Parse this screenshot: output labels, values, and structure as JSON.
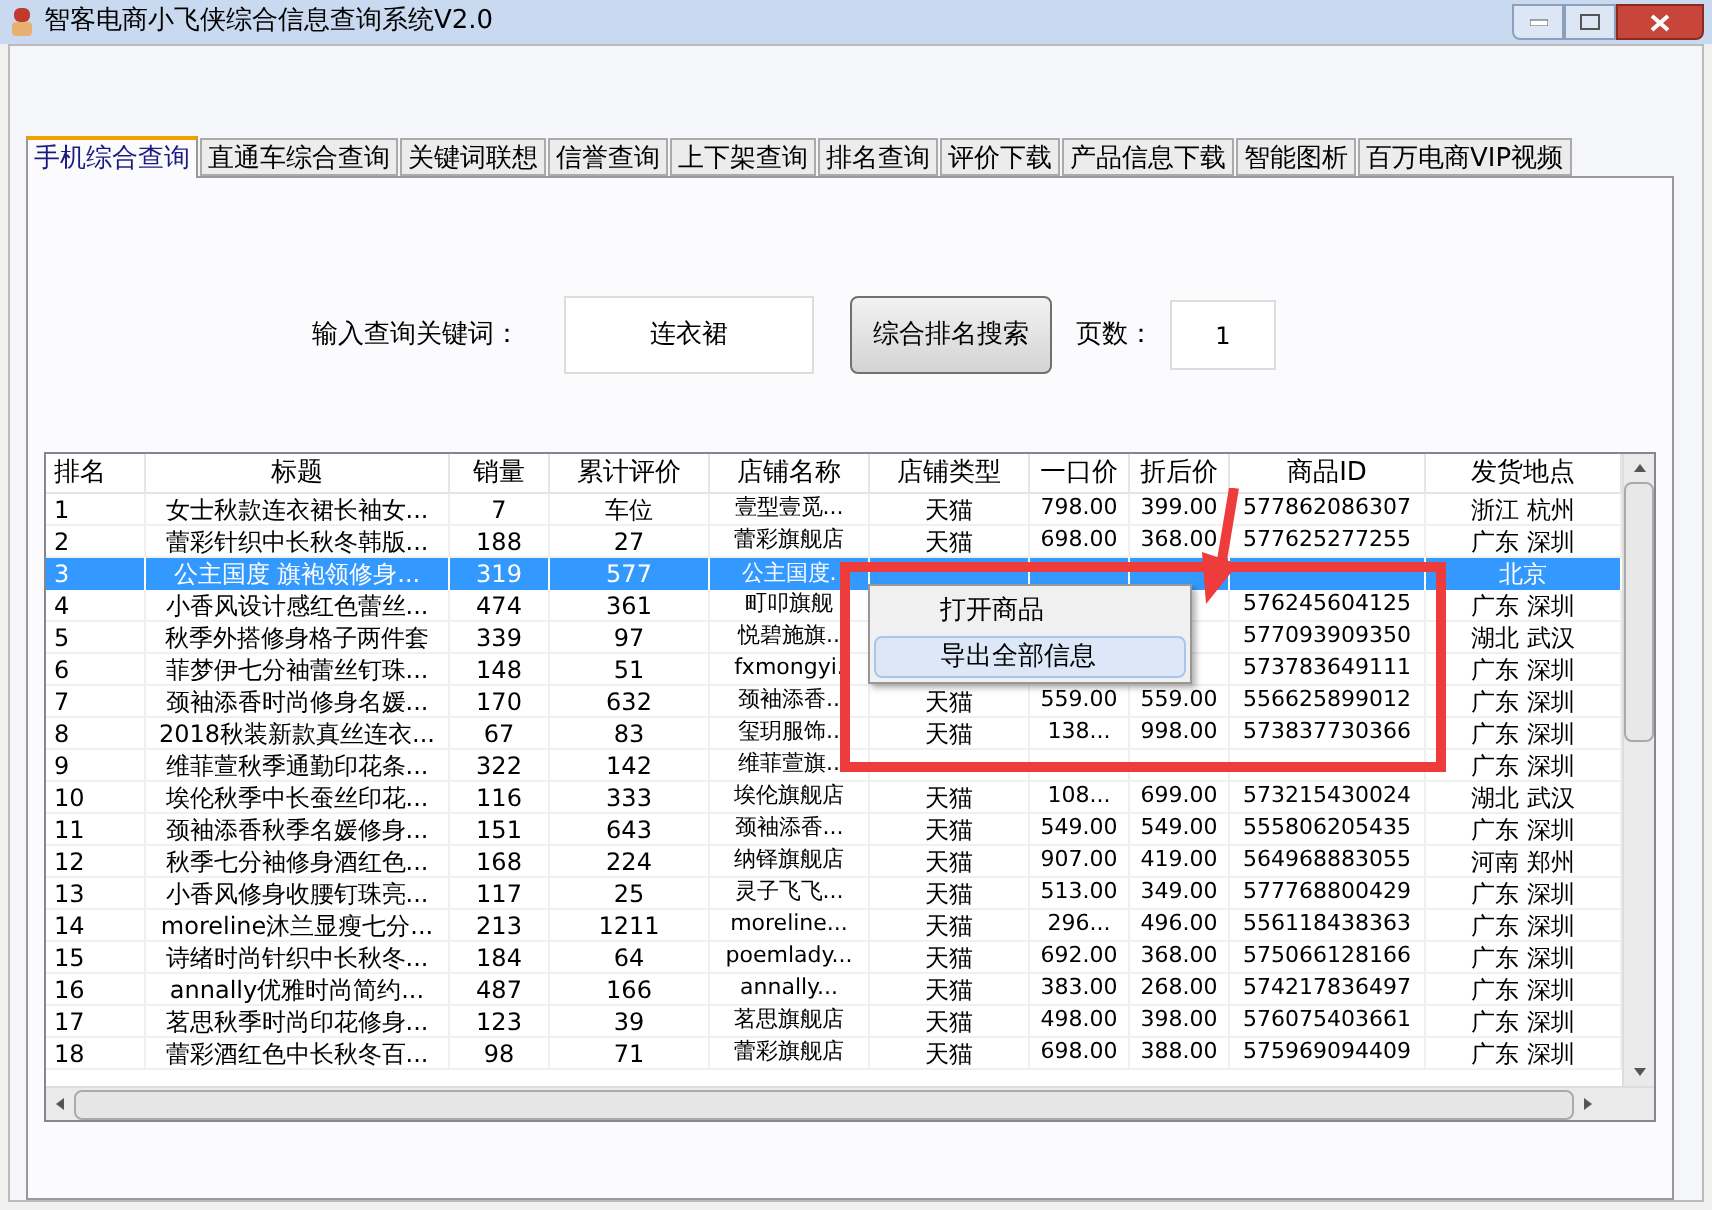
{
  "window": {
    "title": "智客电商小飞侠综合信息查询系统V2.0"
  },
  "tabs": [
    {
      "label": "手机综合查询",
      "selected": true
    },
    {
      "label": "直通车综合查询",
      "selected": false
    },
    {
      "label": "关键词联想",
      "selected": false
    },
    {
      "label": "信誉查询",
      "selected": false
    },
    {
      "label": "上下架查询",
      "selected": false
    },
    {
      "label": "排名查询",
      "selected": false
    },
    {
      "label": "评价下载",
      "selected": false
    },
    {
      "label": "产品信息下载",
      "selected": false
    },
    {
      "label": "智能图析",
      "selected": false
    },
    {
      "label": "百万电商VIP视频",
      "selected": false
    }
  ],
  "search": {
    "label": "输入查询关键词：",
    "value": "连衣裙",
    "button": "综合排名搜索",
    "page_label": "页数：",
    "page_value": "1"
  },
  "table": {
    "columns": [
      "排名",
      "标题",
      "销量",
      "累计评价",
      "店铺名称",
      "店铺类型",
      "一口价",
      "折后价",
      "商品ID",
      "发货地点"
    ],
    "rows": [
      {
        "selected": false,
        "cells": [
          "1",
          "女士秋款连衣裙长袖女...",
          "7",
          "车位",
          "壹型壹觅...",
          "天猫",
          "798.00",
          "399.00",
          "577862086307",
          "浙江 杭州"
        ]
      },
      {
        "selected": false,
        "cells": [
          "2",
          "蕾彩针织中长秋冬韩版...",
          "188",
          "27",
          "蕾彩旗舰店",
          "天猫",
          "698.00",
          "368.00",
          "577625277255",
          "广东 深圳"
        ]
      },
      {
        "selected": true,
        "cells": [
          "3",
          "公主国度 旗袍领修身...",
          "319",
          "577",
          "公主国度.",
          null,
          null,
          null,
          null,
          "北京"
        ]
      },
      {
        "selected": false,
        "cells": [
          "4",
          "小香风设计感红色蕾丝...",
          "474",
          "361",
          "町叩旗舰",
          null,
          null,
          null,
          "576245604125",
          "广东 深圳"
        ]
      },
      {
        "selected": false,
        "cells": [
          "5",
          "秋季外搭修身格子两件套",
          "339",
          "97",
          "悦碧施旗..",
          null,
          null,
          null,
          "577093909350",
          "湖北 武汉"
        ]
      },
      {
        "selected": false,
        "cells": [
          "6",
          "菲梦伊七分袖蕾丝钉珠...",
          "148",
          "51",
          "fxmongyi.",
          null,
          null,
          null,
          "573783649111",
          "广东 深圳"
        ]
      },
      {
        "selected": false,
        "cells": [
          "7",
          "颈袖添香时尚修身名媛...",
          "170",
          "632",
          "颈袖添香..",
          "天猫",
          "559.00",
          "559.00",
          "556625899012",
          "广东 深圳"
        ]
      },
      {
        "selected": false,
        "cells": [
          "8",
          "2018秋装新款真丝连衣...",
          "67",
          "83",
          "玺玥服饰..",
          "天猫",
          "138...",
          "998.00",
          "573837730366",
          "广东 深圳"
        ]
      },
      {
        "selected": false,
        "cells": [
          "9",
          "维菲萱秋季通勤印花条...",
          "322",
          "142",
          "维菲萱旗..",
          null,
          null,
          null,
          null,
          "广东 深圳"
        ]
      },
      {
        "selected": false,
        "cells": [
          "10",
          "埃伦秋季中长蚕丝印花...",
          "116",
          "333",
          "埃伦旗舰店",
          "天猫",
          "108...",
          "699.00",
          "573215430024",
          "湖北 武汉"
        ]
      },
      {
        "selected": false,
        "cells": [
          "11",
          "颈袖添香秋季名媛修身...",
          "151",
          "643",
          "颈袖添香...",
          "天猫",
          "549.00",
          "549.00",
          "555806205435",
          "广东 深圳"
        ]
      },
      {
        "selected": false,
        "cells": [
          "12",
          "秋季七分袖修身酒红色...",
          "168",
          "224",
          "纳铎旗舰店",
          "天猫",
          "907.00",
          "419.00",
          "564968883055",
          "河南 郑州"
        ]
      },
      {
        "selected": false,
        "cells": [
          "13",
          "小香风修身收腰钉珠亮...",
          "117",
          "25",
          "灵子飞飞...",
          "天猫",
          "513.00",
          "349.00",
          "577768800429",
          "广东 深圳"
        ]
      },
      {
        "selected": false,
        "cells": [
          "14",
          "moreline沐兰显瘦七分...",
          "213",
          "1211",
          "moreline...",
          "天猫",
          "296...",
          "496.00",
          "556118438363",
          "广东 深圳"
        ]
      },
      {
        "selected": false,
        "cells": [
          "15",
          "诗绪时尚针织中长秋冬...",
          "184",
          "64",
          "poemlady...",
          "天猫",
          "692.00",
          "368.00",
          "575066128166",
          "广东 深圳"
        ]
      },
      {
        "selected": false,
        "cells": [
          "16",
          "annally优雅时尚简约...",
          "487",
          "166",
          "annally...",
          "天猫",
          "383.00",
          "268.00",
          "574217836497",
          "广东 深圳"
        ]
      },
      {
        "selected": false,
        "cells": [
          "17",
          "茗思秋季时尚印花修身...",
          "123",
          "39",
          "茗思旗舰店",
          "天猫",
          "498.00",
          "398.00",
          "576075403661",
          "广东 深圳"
        ]
      },
      {
        "selected": false,
        "cells": [
          "18",
          "蕾彩酒红色中长秋冬百...",
          "98",
          "71",
          "蕾彩旗舰店",
          "天猫",
          "698.00",
          "388.00",
          "575969094409",
          "广东 深圳"
        ]
      }
    ]
  },
  "context_menu": {
    "items": [
      {
        "label": "打开商品",
        "selected": false
      },
      {
        "label": "导出全部信息",
        "selected": true
      }
    ]
  }
}
